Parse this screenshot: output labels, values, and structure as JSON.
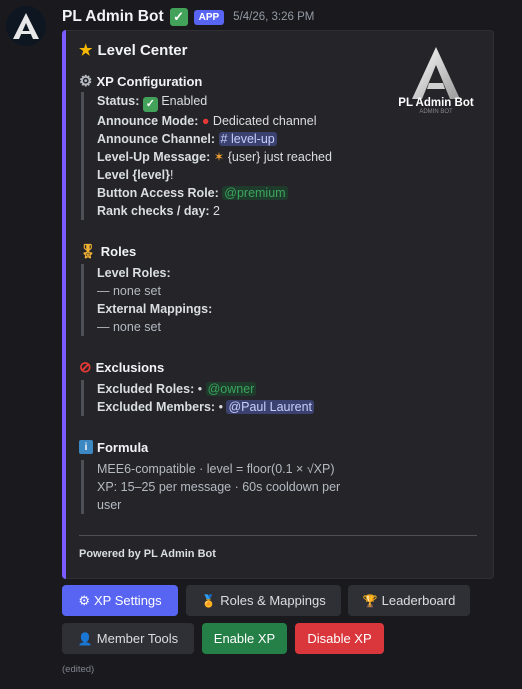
{
  "message": {
    "bot_name": "PL Admin Bot",
    "app_tag": "APP",
    "timestamp": "5/4/26, 3:26 PM",
    "edited": "(edited)"
  },
  "embed": {
    "title": "Level Center",
    "thumbnail_label": "PL Admin Bot",
    "thumbnail_sub": "ADMIN BOT",
    "xp_config": {
      "heading": "XP Configuration",
      "status_label": "Status:",
      "status_value": "Enabled",
      "announce_mode_label": "Announce Mode:",
      "announce_mode_value": "Dedicated channel",
      "announce_channel_label": "Announce Channel:",
      "announce_channel_value": "# level-up",
      "levelup_msg_label": "Level-Up Message:",
      "levelup_msg_value": "{user} just reached",
      "levelup_msg_line2_bold": "Level {level}",
      "levelup_msg_line2_rest": "!",
      "button_role_label": "Button Access Role:",
      "button_role_value": "@premium",
      "rank_checks_label": "Rank checks / day:",
      "rank_checks_value": "2"
    },
    "roles": {
      "heading": "Roles",
      "level_roles_label": "Level Roles:",
      "level_roles_value": "— none set",
      "external_label": "External Mappings:",
      "external_value": "— none set"
    },
    "exclusions": {
      "heading": "Exclusions",
      "excluded_roles_label": "Excluded Roles:",
      "excluded_roles_sep": "•",
      "excluded_roles_value": "@owner",
      "excluded_members_label": "Excluded Members:",
      "excluded_members_sep": "•",
      "excluded_members_value": "@Paul Laurent"
    },
    "formula": {
      "heading": "Formula",
      "line1": "MEE6-compatible · level = floor(0.1 × √XP)",
      "line2": "XP: 15–25 per message · 60s cooldown per",
      "line3": "user"
    },
    "footer": "Powered by PL Admin Bot"
  },
  "buttons": {
    "xp_settings": "XP Settings",
    "roles_mappings": "Roles & Mappings",
    "leaderboard": "Leaderboard",
    "member_tools": "Member Tools",
    "enable_xp": "Enable XP",
    "disable_xp": "Disable XP"
  },
  "colors": {
    "accent_bar": "#7c5cff",
    "primary": "#5865f2",
    "success": "#248046",
    "danger": "#da373c"
  }
}
